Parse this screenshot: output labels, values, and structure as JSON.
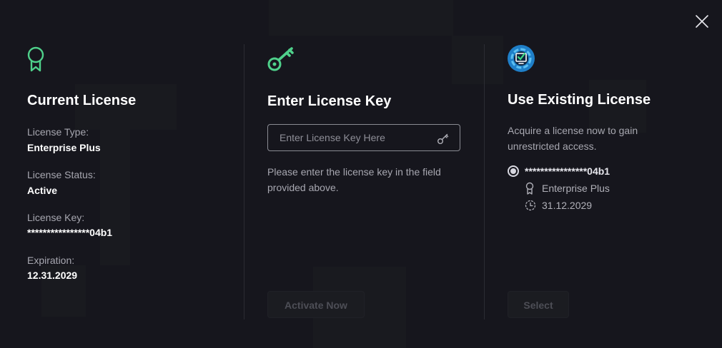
{
  "dialog": {
    "close_icon": "close-icon"
  },
  "current_license": {
    "icon": "award-ribbon-icon",
    "title": "Current License",
    "type_label": "License Type:",
    "type_value": "Enterprise Plus",
    "status_label": "License Status:",
    "status_value": "Active",
    "key_label": "License Key:",
    "key_value": "****************04b1",
    "expiration_label": "Expiration:",
    "expiration_value": "12.31.2029"
  },
  "enter_key": {
    "icon": "key-icon",
    "title": "Enter License Key",
    "input_placeholder": "Enter License Key Here",
    "input_value": "",
    "input_icon": "key-icon",
    "help_text": "Please enter the license key in the field provided above.",
    "activate_label": "Activate Now"
  },
  "existing_license": {
    "icon": "app-logo-icon",
    "title": "Use Existing License",
    "description": "Acquire a license now to gain unrestricted access.",
    "option": {
      "selected": true,
      "key": "****************04b1",
      "edition": "Enterprise Plus",
      "expiry": "31.12.2029"
    },
    "select_label": "Select"
  },
  "colors": {
    "background": "#16161d",
    "accent_green": "#4fd18b",
    "divider": "#2b2c33",
    "muted_text": "#a7a7b0"
  }
}
